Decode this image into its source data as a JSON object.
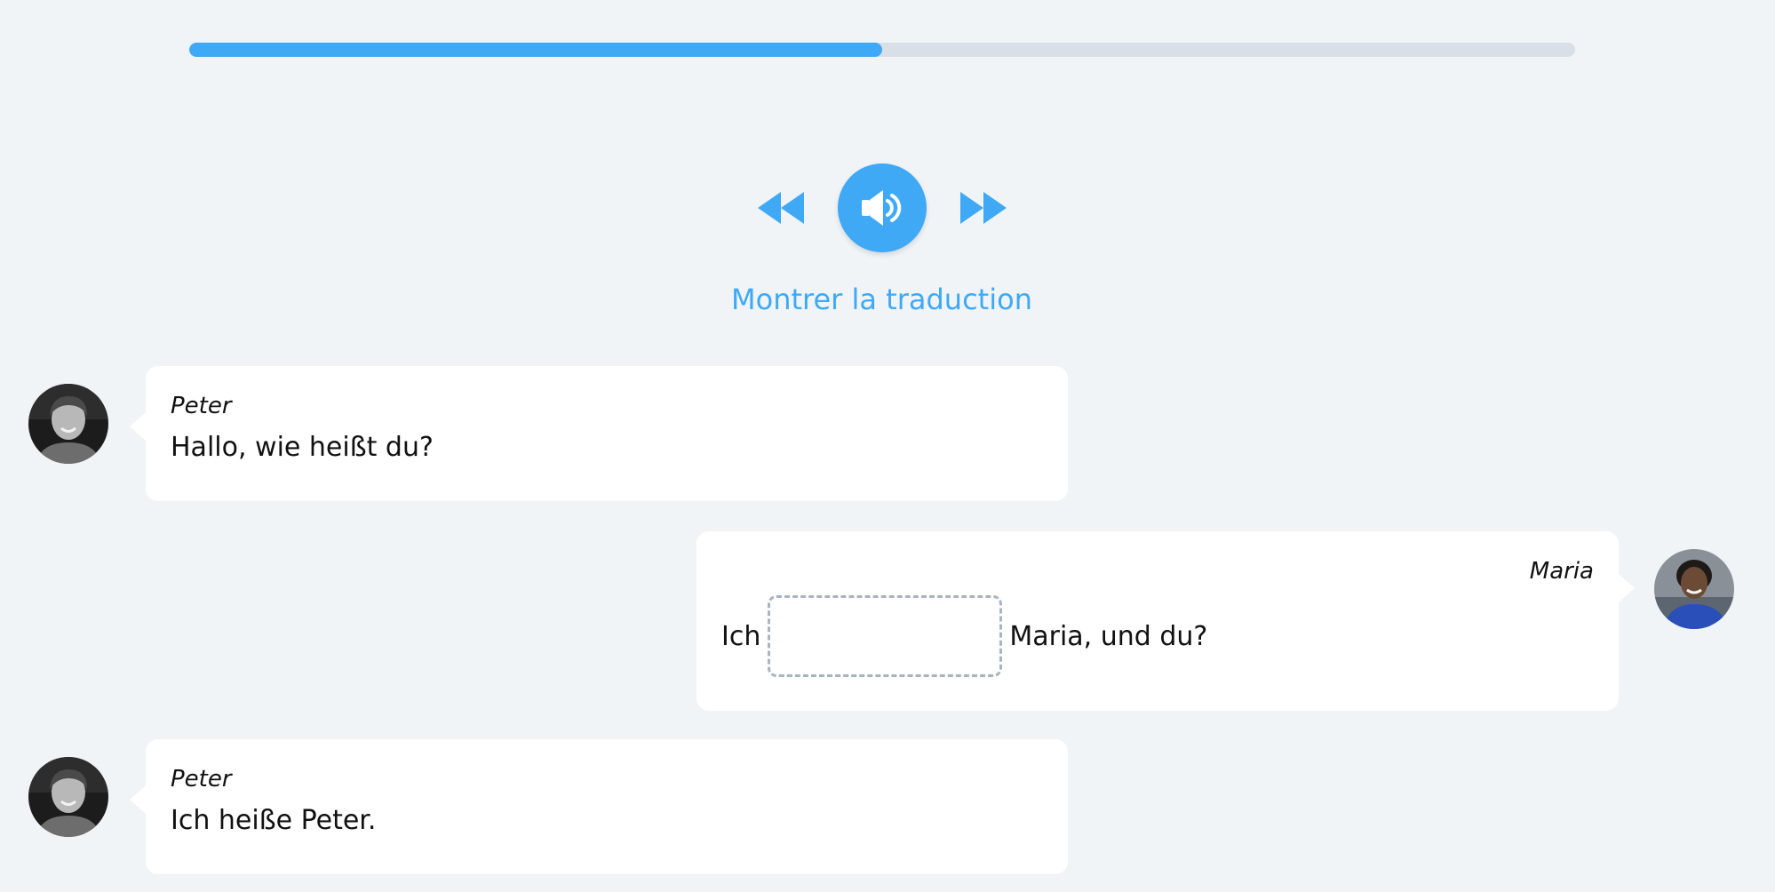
{
  "progress": {
    "percent": 50
  },
  "player": {
    "rewind_icon": "rewind-icon",
    "audio_icon": "speaker-icon",
    "forward_icon": "fast-forward-icon",
    "accent_color": "#3fa9f5"
  },
  "translate_link": "Montrer la traduction",
  "dialogue": [
    {
      "speaker": "Peter",
      "text": "Hallo, wie heißt du?",
      "side": "left"
    },
    {
      "speaker": "Maria",
      "before_gap": "Ich",
      "after_gap": "Maria, und du?",
      "side": "right"
    },
    {
      "speaker": "Peter",
      "text": "Ich heiße Peter.",
      "side": "left"
    }
  ]
}
